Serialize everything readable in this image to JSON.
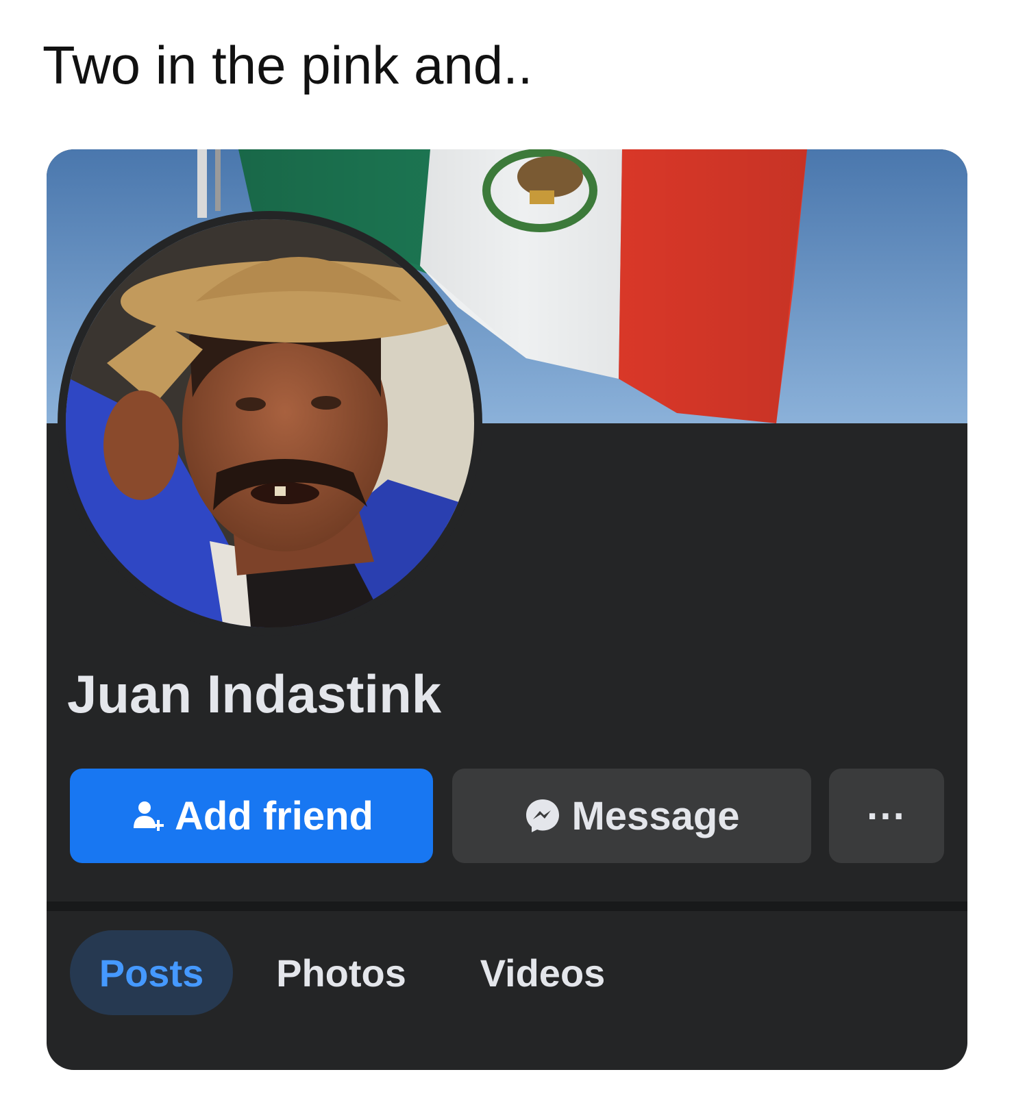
{
  "post": {
    "caption": "Two in the pink and.."
  },
  "profile": {
    "name": "Juan Indastink",
    "cover_photo": "mexican-flag-cover",
    "profile_photo": "man-in-straw-hat"
  },
  "actions": {
    "add_friend_label": "Add friend",
    "add_friend_icon": "person-add-icon",
    "message_label": "Message",
    "message_icon": "messenger-icon",
    "more_label": "···"
  },
  "tabs": [
    {
      "label": "Posts",
      "active": true
    },
    {
      "label": "Photos",
      "active": false
    },
    {
      "label": "Videos",
      "active": false
    }
  ],
  "colors": {
    "primary_button": "#1877f2",
    "secondary_button": "#3a3b3c",
    "card_background": "#242526",
    "active_tab_text": "#4599ff",
    "active_tab_background": "#263951"
  }
}
